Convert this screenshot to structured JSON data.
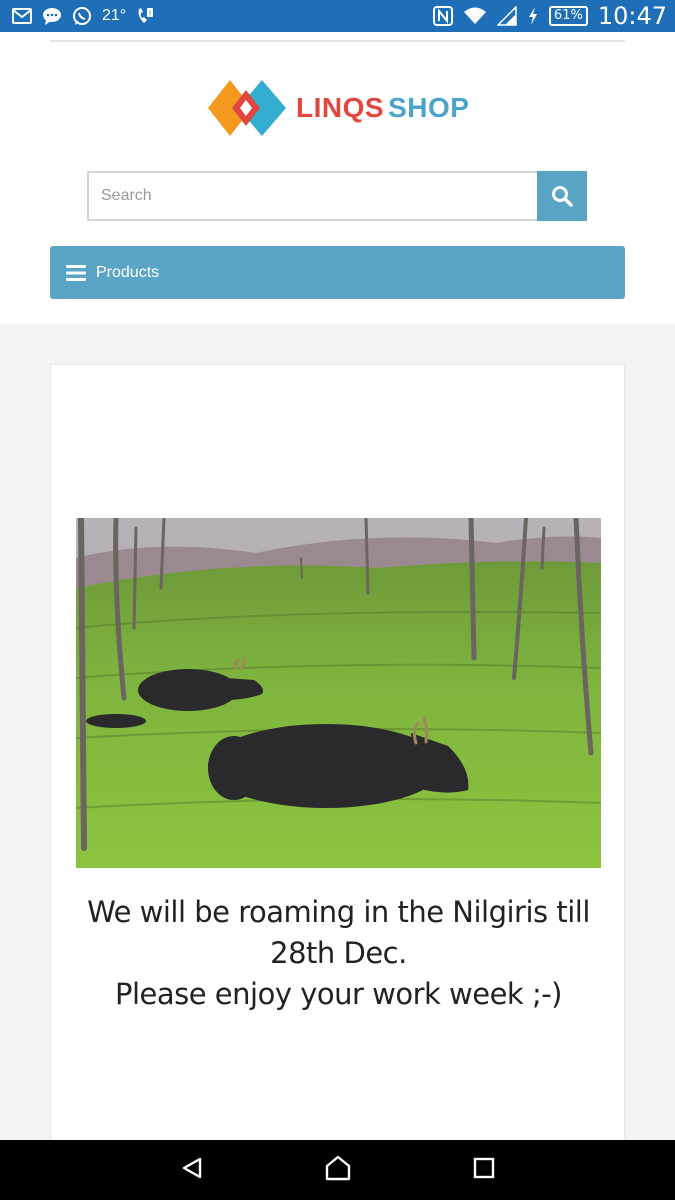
{
  "status_bar": {
    "temperature": "21°",
    "battery": "61%",
    "time": "10:47",
    "left_icons": [
      "gmail-icon",
      "chat-icon",
      "whatsapp-icon",
      "temperature",
      "phone-icon"
    ],
    "right_icons": [
      "nfc-icon",
      "wifi-icon",
      "signal-icon",
      "battery-icon"
    ]
  },
  "logo": {
    "part1": "LINQS",
    "part2": "SHOP",
    "colors": {
      "orange": "#f39a1e",
      "red": "#e2473f",
      "blue": "#33aed0"
    }
  },
  "search": {
    "placeholder": "Search"
  },
  "nav": {
    "label": "Products"
  },
  "promo": {
    "line1": "We will be roaming in the Nilgiris till",
    "line2": "28th Dec.",
    "line3": "Please enjoy your work week ;-)"
  },
  "theme": {
    "accent": "#5aa4c6",
    "status_bar": "#1f6fb8"
  }
}
